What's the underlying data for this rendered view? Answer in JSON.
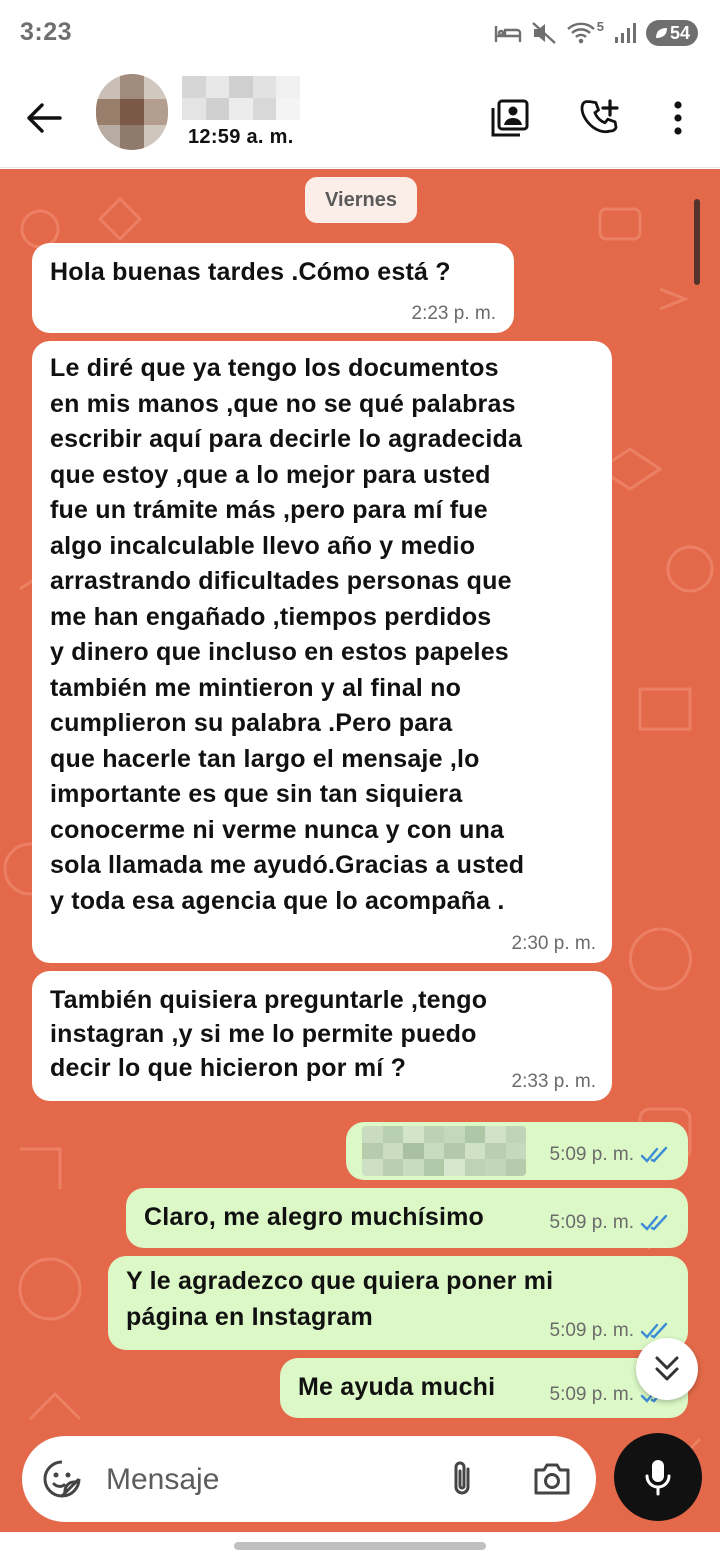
{
  "status_bar": {
    "time": "3:23",
    "network": "5",
    "battery": "54"
  },
  "header": {
    "last_seen": "12:59 a. m."
  },
  "chat": {
    "date_chip": "Viernes",
    "messages": [
      {
        "direction": "in",
        "text": "Hola buenas tardes .Cómo está ?",
        "time": "2:23 p. m."
      },
      {
        "direction": "in",
        "text": "Le diré que ya tengo los documentos\nen mis manos ,que no se qué palabras\nescribir aquí para decirle  lo agradecida\nque estoy ,que a lo mejor para usted\nfue un trámite más ,pero para mí fue\nalgo incalculable llevo año y medio\narrastrando dificultades personas que\nme han engañado ,tiempos perdidos\ny dinero que incluso en estos papeles\ntambién me mintieron y al final no\ncumplieron su palabra .Pero para\nque hacerle tan largo el mensaje ,lo\nimportante es que sin tan siquiera\nconocerme ni verme nunca y con una\nsola llamada me ayudó.Gracias a usted\ny toda esa agencia que lo acompaña .",
        "time": "2:30 p. m."
      },
      {
        "direction": "in",
        "text": "También quisiera preguntarle ,tengo\ninstagran ,y si me lo permite puedo\ndecir lo que hicieron por mí ?",
        "time": "2:33 p. m."
      },
      {
        "direction": "out",
        "text": "",
        "time": "5:09 p. m.",
        "status": "read"
      },
      {
        "direction": "out",
        "text": "Claro, me alegro muchísimo",
        "time": "5:09 p. m.",
        "status": "read"
      },
      {
        "direction": "out",
        "text": "Y le agradezco que quiera poner mi\npágina en Instagram",
        "time": "5:09 p. m.",
        "status": "read"
      },
      {
        "direction": "out",
        "text": "Me ayuda muchi",
        "time": "5:09 p. m.",
        "status": "read"
      }
    ]
  },
  "composer": {
    "placeholder": "Mensaje"
  },
  "colors": {
    "wallpaper": "#e4694a",
    "incoming_bubble": "#ffffff",
    "outgoing_bubble": "#dcf8c6",
    "read_ticks": "#3b8cd6",
    "mic_button": "#111111"
  },
  "icons": {
    "back": "arrow-left-icon",
    "contact_card": "contact-card-icon",
    "add_call": "phone-plus-icon",
    "more": "more-vertical-icon",
    "emoji": "sticker-emoji-icon",
    "attach": "paperclip-icon",
    "camera": "camera-icon",
    "mic": "microphone-icon",
    "scroll_down": "double-chevron-down-icon"
  }
}
